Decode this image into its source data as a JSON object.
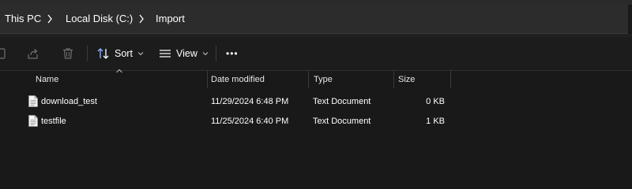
{
  "breadcrumb": {
    "items": [
      "This PC",
      "Local Disk (C:)",
      "Import"
    ]
  },
  "toolbar": {
    "sort_label": "Sort",
    "view_label": "View",
    "more_label": "•••"
  },
  "columns": {
    "name": "Name",
    "date_modified": "Date modified",
    "type": "Type",
    "size": "Size"
  },
  "files": [
    {
      "name": "download_test",
      "date_modified": "11/29/2024 6:48 PM",
      "type": "Text Document",
      "size": "0 KB",
      "icon": "text-document-icon"
    },
    {
      "name": "testfile",
      "date_modified": "11/25/2024 6:40 PM",
      "type": "Text Document",
      "size": "1 KB",
      "icon": "text-document-icon"
    }
  ],
  "colors": {
    "background": "#191919",
    "address_bar": "#2c2c2c",
    "toolbar": "#1c1c1c",
    "text": "#ffffff",
    "divider": "#3a3a3a"
  }
}
